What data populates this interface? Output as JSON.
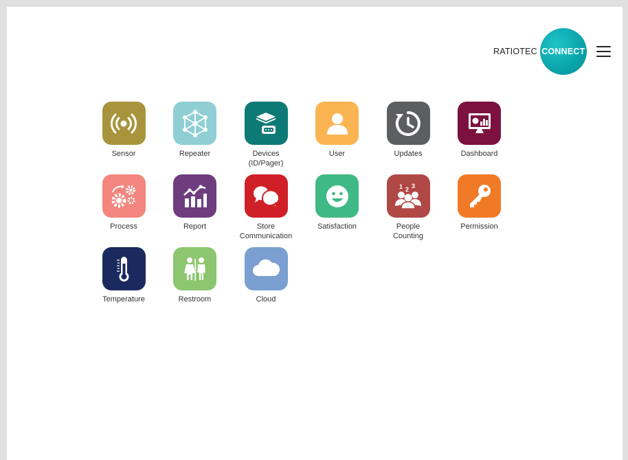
{
  "header": {
    "brand_text": "RATIOTEC",
    "brand_badge": "CONNECT",
    "brand_color": "#0aa3aa"
  },
  "menu": {
    "icon": "hamburger-menu-icon"
  },
  "apps": [
    {
      "id": "sensor",
      "label": "Sensor",
      "icon": "wireless-signal-icon",
      "color": "#a7943c"
    },
    {
      "id": "repeater",
      "label": "Repeater",
      "icon": "network-nodes-icon",
      "color": "#8fcfd4"
    },
    {
      "id": "devices",
      "label": "Devices\n(ID/Pager)",
      "icon": "devices-stack-icon",
      "color": "#0e7a75"
    },
    {
      "id": "user",
      "label": "User",
      "icon": "user-icon",
      "color": "#fbb452"
    },
    {
      "id": "updates",
      "label": "Updates",
      "icon": "clock-refresh-icon",
      "color": "#5d5e60"
    },
    {
      "id": "dashboard",
      "label": "Dashboard",
      "icon": "monitor-chart-icon",
      "color": "#7c1140"
    },
    {
      "id": "process",
      "label": "Process",
      "icon": "gears-icon",
      "color": "#f4857f"
    },
    {
      "id": "report",
      "label": "Report",
      "icon": "bar-chart-icon",
      "color": "#6e3d7f"
    },
    {
      "id": "store-communication",
      "label": "Store\nCommunication",
      "icon": "chat-bubbles-icon",
      "color": "#cf2027"
    },
    {
      "id": "satisfaction",
      "label": "Satisfaction",
      "icon": "smiley-icon",
      "color": "#3fb985"
    },
    {
      "id": "people-counting",
      "label": "People\nCounting",
      "icon": "group-counting-icon",
      "color": "#b04846"
    },
    {
      "id": "permission",
      "label": "Permission",
      "icon": "key-icon",
      "color": "#f07a25"
    },
    {
      "id": "temperature",
      "label": "Temperature",
      "icon": "thermometer-icon",
      "color": "#1b2a5e"
    },
    {
      "id": "restroom",
      "label": "Restroom",
      "icon": "restroom-icon",
      "color": "#8cc66f"
    },
    {
      "id": "cloud",
      "label": "Cloud",
      "icon": "cloud-icon",
      "color": "#7a9fd0"
    }
  ]
}
